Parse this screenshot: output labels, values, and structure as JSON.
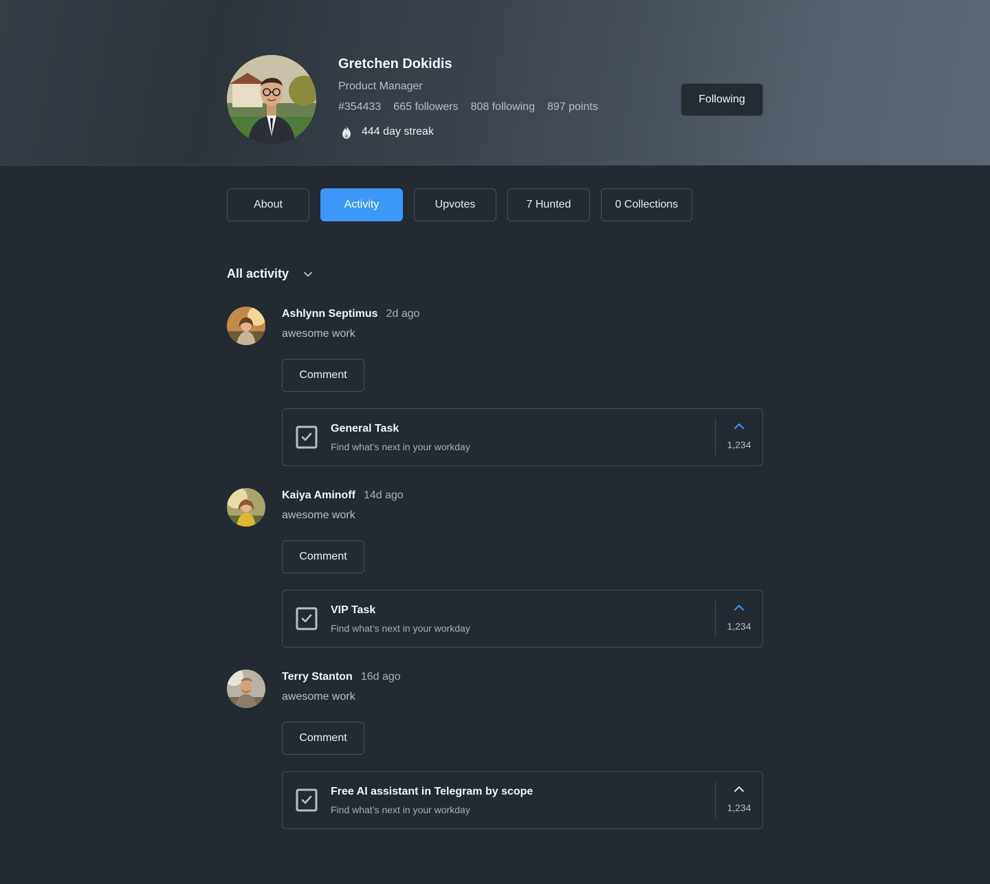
{
  "profile": {
    "name": "Gretchen Dokidis",
    "role": "Product Manager",
    "stats": [
      "#354433",
      "665 followers",
      "808 following",
      "897 points"
    ],
    "streak": "444 day streak",
    "follow_label": "Following"
  },
  "tabs": [
    {
      "label": "About",
      "active": false
    },
    {
      "label": "Activity",
      "active": true
    },
    {
      "label": "Upvotes",
      "active": false
    },
    {
      "label": "7 Hunted",
      "active": false
    },
    {
      "label": "0 Collections",
      "active": false
    }
  ],
  "filter": {
    "label": "All activity",
    "icon": "chevron-down-icon"
  },
  "activities": [
    {
      "user": "Ashlynn Septimus",
      "time": "2d ago",
      "text": "awesome work",
      "comment_label": "Comment",
      "card": {
        "title": "General Task",
        "subtitle": "Find what’s next in your workday",
        "count": "1,234",
        "upvoted": true
      }
    },
    {
      "user": "Kaiya Aminoff",
      "time": "14d ago",
      "text": "awesome work",
      "comment_label": "Comment",
      "card": {
        "title": "VIP Task",
        "subtitle": "Find what’s next in your workday",
        "count": "1,234",
        "upvoted": true
      }
    },
    {
      "user": "Terry Stanton",
      "time": "16d ago",
      "text": "awesome work",
      "comment_label": "Comment",
      "card": {
        "title": "Free AI assistant in Telegram by scope",
        "subtitle": "Find what’s next in your workday",
        "count": "1,234",
        "upvoted": false
      }
    }
  ],
  "colors": {
    "accent": "#3d97fb",
    "background": "#232a32",
    "upvote_inactive": "#dfe3e8"
  }
}
